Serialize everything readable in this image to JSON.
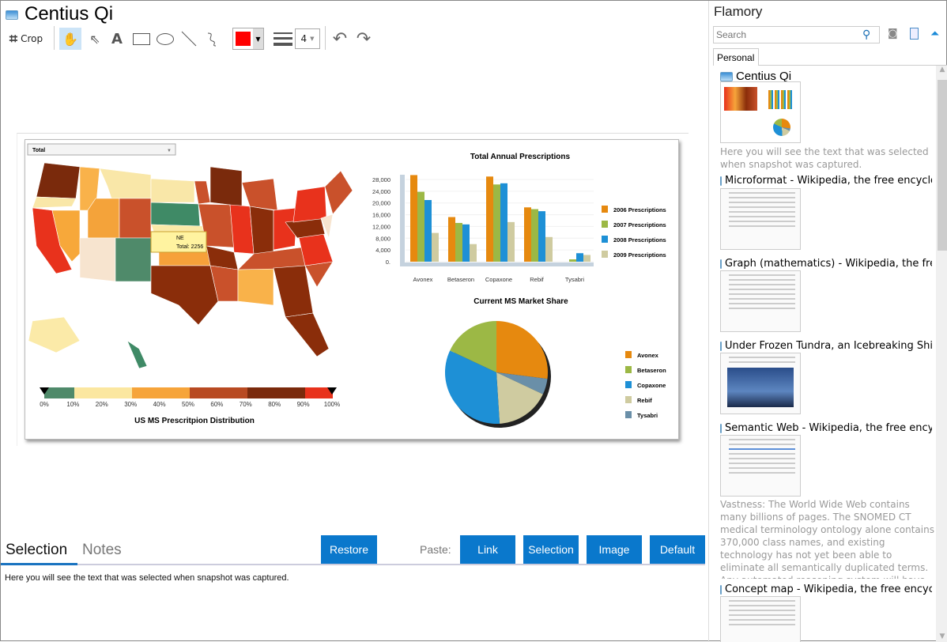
{
  "window": {
    "title": "Centius Qi"
  },
  "toolbar": {
    "crop_label": "Crop",
    "line_width": "4",
    "color": "#ff0000"
  },
  "snapshot": {
    "dropdown_value": "Total",
    "tooltip": {
      "state": "NE",
      "total": "Total: 2256"
    },
    "scale_labels": [
      "0%",
      "10%",
      "20%",
      "30%",
      "40%",
      "50%",
      "60%",
      "70%",
      "80%",
      "90%",
      "100%"
    ],
    "map_title": "US MS Prescritpion Distribution"
  },
  "chart_data": [
    {
      "type": "bar",
      "title": "Total Annual Prescriptions",
      "categories": [
        "Avonex",
        "Betaseron",
        "Copaxone",
        "Rebif",
        "Tysabri"
      ],
      "yticks": [
        "28,000",
        "24,000",
        "20,000",
        "16,000",
        "12,000",
        "8,000",
        "4,000",
        "0."
      ],
      "ylim": [
        0,
        28000
      ],
      "series": [
        {
          "name": "2006 Prescriptions",
          "color": "#e6890f",
          "values": [
            29500,
            15200,
            29000,
            18500,
            0
          ]
        },
        {
          "name": "2007 Prescriptions",
          "color": "#9cb845",
          "values": [
            23800,
            13200,
            26300,
            17900,
            800
          ]
        },
        {
          "name": "2008 Prescriptions",
          "color": "#1e90d6",
          "values": [
            21000,
            12700,
            26700,
            17200,
            2900
          ]
        },
        {
          "name": "2009 Prescriptions",
          "color": "#cfcba0",
          "values": [
            9800,
            6000,
            13500,
            8400,
            2300
          ]
        }
      ],
      "legend": "right"
    },
    {
      "type": "pie",
      "title": "Current MS Market Share",
      "labels": [
        "Avonex",
        "Betaseron",
        "Copaxone",
        "Rebif",
        "Tysabri"
      ],
      "values": [
        27,
        18,
        33,
        17,
        5
      ],
      "colors": [
        "#e6890f",
        "#9cb845",
        "#1e90d6",
        "#cfcba0",
        "#6a8fa8"
      ],
      "legend": "right"
    }
  ],
  "bottom": {
    "tabs": [
      "Selection",
      "Notes"
    ],
    "restore": "Restore",
    "paste_label": "Paste:",
    "paste_buttons": [
      "Link",
      "Selection",
      "Image",
      "Default"
    ],
    "selection_text": "Here you will see the text that was selected when snapshot was captured."
  },
  "sidebar": {
    "app_title": "Flamory",
    "search_placeholder": "Search",
    "tab": "Personal",
    "entries": [
      {
        "title": "Centius Qi",
        "desc": "Here you will see the text that was selected when snapshot was captured."
      },
      {
        "title": "Microformat - Wikipedia, the free encyclopedia"
      },
      {
        "title": "Graph (mathematics) - Wikipedia, the free encyclopedia"
      },
      {
        "title": "Under Frozen Tundra, an Icebreaking Ship Uncovers"
      },
      {
        "title": "Semantic Web - Wikipedia, the free encyclopedia",
        "desc": "Vastness: The World Wide Web contains many billions of pages. The SNOMED CT medical terminology ontology alone contains 370,000 class names, and existing technology has not yet been able to eliminate all semantically duplicated terms. Any automated reasoning system will have to deal with truly huge inputs."
      },
      {
        "title": "Concept map - Wikipedia, the free encyclopedia"
      }
    ]
  }
}
